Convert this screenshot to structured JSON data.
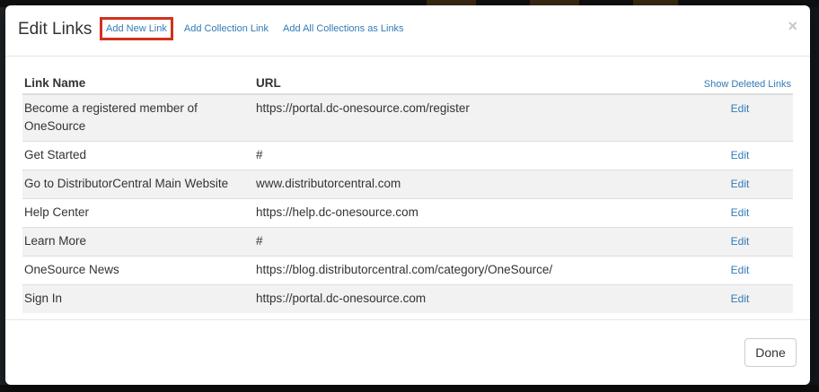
{
  "modal": {
    "title": "Edit Links",
    "header_links": [
      {
        "label": "Add New Link"
      },
      {
        "label": "Add Collection Link"
      },
      {
        "label": "Add All Collections as Links"
      }
    ],
    "close_symbol": "×",
    "table": {
      "headers": {
        "name": "Link Name",
        "url": "URL",
        "action": "Show Deleted Links"
      },
      "edit_label": "Edit",
      "rows": [
        {
          "name": "Become a registered member of OneSource",
          "url": "https://portal.dc-onesource.com/register"
        },
        {
          "name": "Get Started",
          "url": "#"
        },
        {
          "name": "Go to DistributorCentral Main Website",
          "url": "www.distributorcentral.com"
        },
        {
          "name": "Help Center",
          "url": "https://help.dc-onesource.com"
        },
        {
          "name": "Learn More",
          "url": "#"
        },
        {
          "name": "OneSource News",
          "url": "https://blog.distributorcentral.com/category/OneSource/"
        },
        {
          "name": "Sign In",
          "url": "https://portal.dc-onesource.com"
        }
      ]
    },
    "footer": {
      "done_label": "Done"
    }
  },
  "colors": {
    "link": "#337ab7",
    "highlight_border": "#d0321f",
    "row_stripe": "#f2f2f2"
  },
  "icons": {
    "close": "close-icon"
  }
}
